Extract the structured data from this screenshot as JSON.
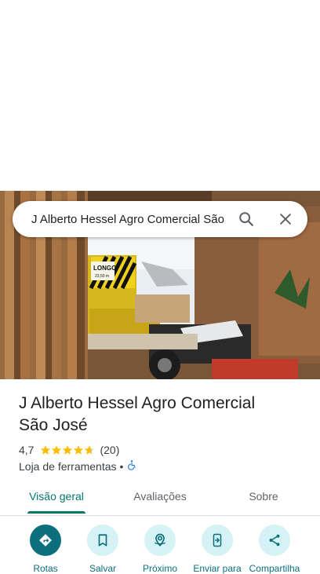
{
  "search": {
    "query": "J Alberto Hessel Agro Comercial São José"
  },
  "photo": {
    "sign_text": "LONGO",
    "sign_subtext": "23,50 m"
  },
  "place": {
    "name_line1": "J Alberto Hessel Agro Comercial",
    "name_line2": "São José",
    "rating": "4,7",
    "stars": 4.7,
    "reviews": "(20)",
    "category": "Loja de ferramentas",
    "separator": "•"
  },
  "tabs": [
    {
      "label": "Visão geral",
      "active": true
    },
    {
      "label": "Avaliações",
      "active": false
    },
    {
      "label": "Sobre",
      "active": false
    }
  ],
  "actions": [
    {
      "label": "Rotas",
      "icon": "directions-icon"
    },
    {
      "label": "Salvar",
      "icon": "bookmark-icon"
    },
    {
      "label": "Próximo",
      "icon": "nearby-icon"
    },
    {
      "label": "Enviar para",
      "icon": "send-to-phone-icon"
    },
    {
      "label": "Compartilha",
      "icon": "share-icon"
    }
  ],
  "colors": {
    "accent": "#0b6f7c",
    "star": "#fbbc04",
    "tab_active": "#00796b"
  }
}
